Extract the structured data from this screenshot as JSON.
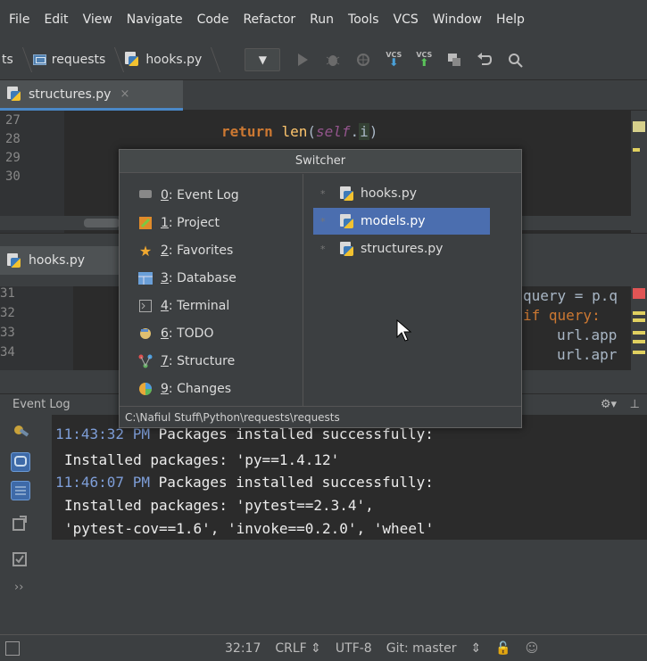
{
  "menu": [
    {
      "label": "File"
    },
    {
      "label": "Edit"
    },
    {
      "label": "View"
    },
    {
      "label": "Navigate"
    },
    {
      "label": "Code"
    },
    {
      "label": "Refactor"
    },
    {
      "label": "Run"
    },
    {
      "label": "Tools"
    },
    {
      "label": "VCS"
    },
    {
      "label": "Window"
    },
    {
      "label": "Help"
    }
  ],
  "breadcrumbs": {
    "prefix": "ts",
    "folder": "requests",
    "file": "hooks.py"
  },
  "toolbar": {
    "vcs_update": "VCS",
    "vcs_commit": "VCS"
  },
  "editor_tab": {
    "file": "structures.py",
    "close": "×"
  },
  "editor_top": {
    "line_numbers": [
      "27",
      "28",
      "29",
      "30"
    ],
    "code": {
      "kw": "return",
      "fn": "len",
      "self": "self",
      "rest": "i"
    }
  },
  "editor_tab2": {
    "file": "hooks.py"
  },
  "editor_bottom": {
    "line_numbers": [
      "31",
      "32",
      "33",
      "34"
    ],
    "code": [
      "query = p.q",
      "if query:",
      "url.app",
      "url.apr"
    ]
  },
  "switcher": {
    "title": "Switcher",
    "tools": [
      {
        "num": "0",
        "label": "Event Log"
      },
      {
        "num": "1",
        "label": "Project"
      },
      {
        "num": "2",
        "label": "Favorites"
      },
      {
        "num": "3",
        "label": "Database"
      },
      {
        "num": "4",
        "label": "Terminal"
      },
      {
        "num": "6",
        "label": "TODO"
      },
      {
        "num": "7",
        "label": "Structure"
      },
      {
        "num": "9",
        "label": "Changes"
      }
    ],
    "files": [
      {
        "label": "hooks.py",
        "star": "*"
      },
      {
        "label": "models.py",
        "star": "*"
      },
      {
        "label": "structures.py",
        "star": "*"
      }
    ],
    "path": "C:\\Nafiul Stuff\\Python\\requests\\requests"
  },
  "event_log": {
    "title": "Event Log",
    "lines": [
      {
        "time": "11:43:32 PM",
        "text": " Packages installed successfully:"
      },
      {
        "time": "",
        "text": "Installed packages: 'py==1.4.12'"
      },
      {
        "time": "11:46:07 PM",
        "text": " Packages installed successfully:"
      },
      {
        "time": "",
        "text": "Installed packages: 'pytest==2.3.4',"
      },
      {
        "time": "",
        "text": "'pytest-cov==1.6', 'invoke==0.2.0', 'wheel'"
      }
    ]
  },
  "status": {
    "position": "32:17",
    "line_sep": "CRLF ⇕",
    "encoding": "UTF-8",
    "vcs": "Git: master",
    "vcs_arrow": "⇕"
  }
}
